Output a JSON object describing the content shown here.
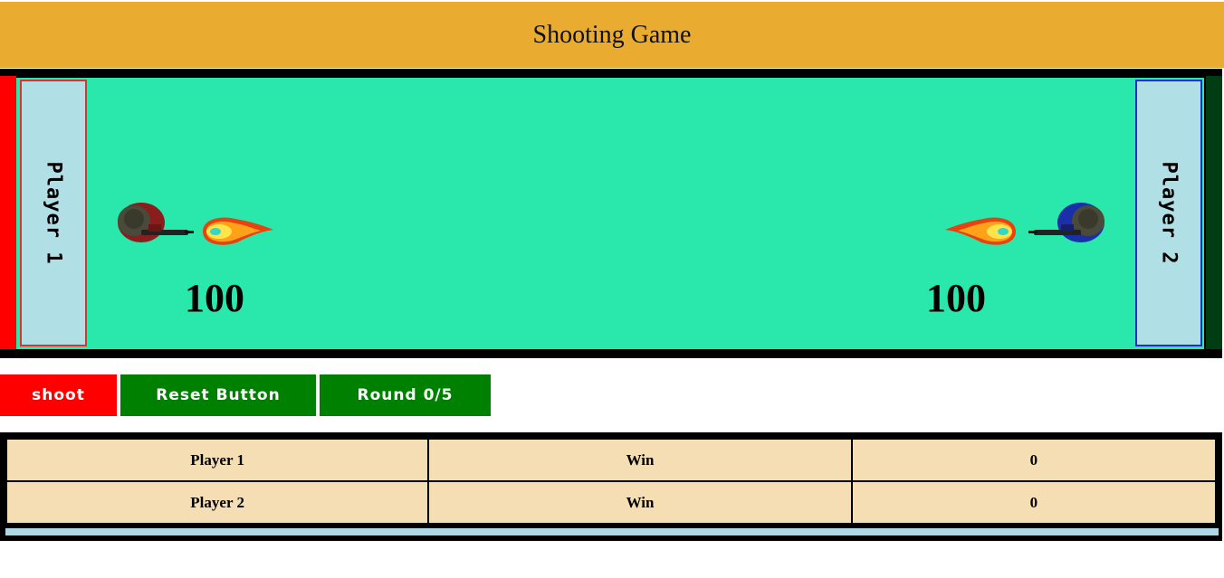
{
  "header": {
    "title": "Shooting Game"
  },
  "arena": {
    "player1": {
      "label": "Player 1",
      "health": "100",
      "color": "#ff0000"
    },
    "player2": {
      "label": "Player 2",
      "health": "100",
      "color": "#003d12"
    }
  },
  "controls": {
    "shoot_label": "shoot",
    "reset_label": "Reset Button",
    "round_label": "Round 0/5"
  },
  "scoreboard": {
    "rows": [
      {
        "player": "Player 1",
        "status": "Win",
        "count": "0"
      },
      {
        "player": "Player 2",
        "status": "Win",
        "count": "0"
      }
    ]
  }
}
